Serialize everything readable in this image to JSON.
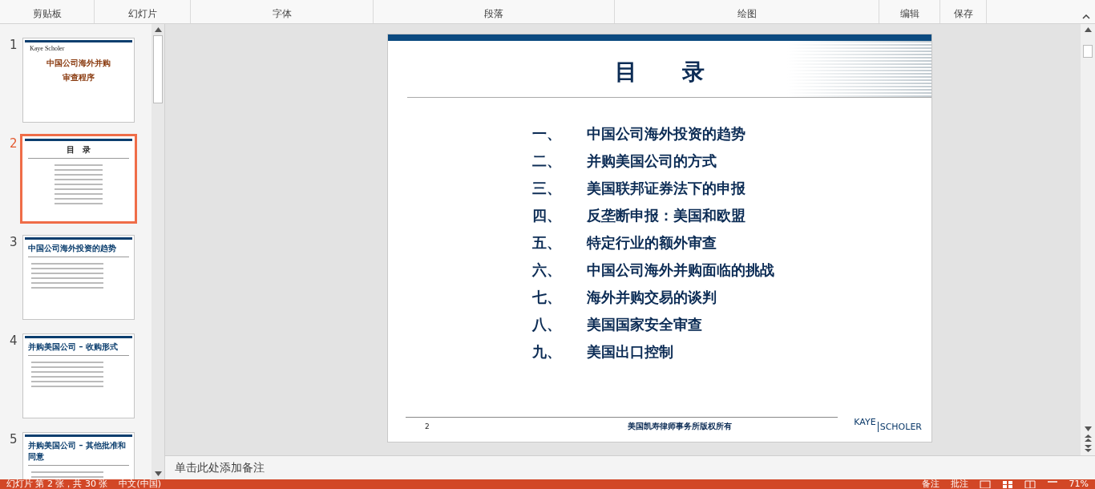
{
  "ribbon": {
    "groups": [
      "剪贴板",
      "幻灯片",
      "字体",
      "段落",
      "绘图",
      "编辑",
      "保存"
    ]
  },
  "thumbnails": [
    {
      "number": "1",
      "selected": false,
      "kind": "cover",
      "lines": [
        "Kaye Scholer",
        "中国公司海外并购",
        "审查程序"
      ]
    },
    {
      "number": "2",
      "selected": true,
      "kind": "toc",
      "lines": [
        "目　录"
      ]
    },
    {
      "number": "3",
      "selected": false,
      "kind": "content",
      "lines": [
        "中国公司海外投资的趋势"
      ]
    },
    {
      "number": "4",
      "selected": false,
      "kind": "content",
      "lines": [
        "并购美国公司 – 收购形式"
      ]
    },
    {
      "number": "5",
      "selected": false,
      "kind": "content",
      "lines": [
        "并购美国公司 – 其他批准和同意"
      ]
    }
  ],
  "slide": {
    "title": "目　　录",
    "items": [
      {
        "number": "一、",
        "text": "中国公司海外投资的趋势"
      },
      {
        "number": "二、",
        "text": "并购美国公司的方式"
      },
      {
        "number": "三、",
        "text": "美国联邦证券法下的申报"
      },
      {
        "number": "四、",
        "text": "反垄断申报：美国和欧盟"
      },
      {
        "number": "五、",
        "text": "特定行业的额外审查"
      },
      {
        "number": "六、",
        "text": "中国公司海外并购面临的挑战"
      },
      {
        "number": "七、",
        "text": "海外并购交易的谈判"
      },
      {
        "number": "八、",
        "text": "美国国家安全审查"
      },
      {
        "number": "九、",
        "text": "美国出口控制"
      }
    ],
    "page_number": "2",
    "footer": "美国凯寿律师事务所版权所有",
    "logo": [
      "KAYE",
      "SCHOLER"
    ]
  },
  "notes": {
    "placeholder": "单击此处添加备注"
  },
  "status_bar": {
    "slide_info": "幻灯片 第 2 张，共 30 张",
    "language": "中文(中国)",
    "notes": "备注",
    "comments": "批注",
    "zoom": "71%"
  }
}
